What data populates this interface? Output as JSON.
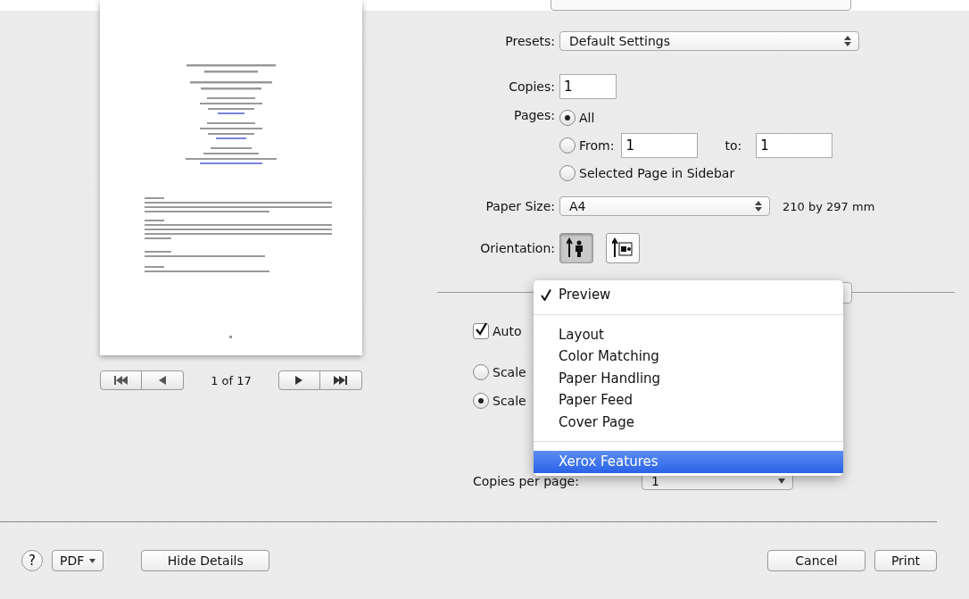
{
  "page_nav": {
    "label": "1 of 17"
  },
  "presets": {
    "label": "Presets:",
    "value": "Default Settings"
  },
  "copies": {
    "label": "Copies:",
    "value": "1"
  },
  "pages": {
    "label": "Pages:",
    "options": [
      {
        "kind": "all",
        "label": "All",
        "selected": true
      },
      {
        "kind": "range",
        "label": "From:",
        "from": "1",
        "to_label": "to:",
        "to": "1",
        "selected": false
      },
      {
        "kind": "plain",
        "label": "Selected Page in Sidebar",
        "selected": false
      }
    ]
  },
  "paper_size": {
    "label": "Paper Size:",
    "value": "A4",
    "note": "210 by 297 mm"
  },
  "orientation": {
    "label": "Orientation:",
    "options": [
      {
        "kind": "portrait",
        "selected": true
      },
      {
        "kind": "landscape",
        "selected": false
      }
    ]
  },
  "panel_menu": {
    "groups": [
      [
        {
          "label": "Preview",
          "checked": true,
          "highlighted": false
        }
      ],
      [
        {
          "label": "Layout",
          "checked": false,
          "highlighted": false
        },
        {
          "label": "Color Matching",
          "checked": false,
          "highlighted": false
        },
        {
          "label": "Paper Handling",
          "checked": false,
          "highlighted": false
        },
        {
          "label": "Paper Feed",
          "checked": false,
          "highlighted": false
        },
        {
          "label": "Cover Page",
          "checked": false,
          "highlighted": false
        }
      ],
      [
        {
          "label": "Xerox Features",
          "checked": false,
          "highlighted": true
        }
      ]
    ]
  },
  "auto_rotate": {
    "label": "Auto",
    "checked": true
  },
  "scale_options": [
    {
      "label": "Scale",
      "selected": false
    },
    {
      "label": "Scale",
      "selected": true
    }
  ],
  "copies_per_page": {
    "label": "Copies per page:",
    "value": "1"
  },
  "footer": {
    "help": "?",
    "pdf": "PDF",
    "hide_details": "Hide Details",
    "cancel": "Cancel",
    "print": "Print"
  }
}
